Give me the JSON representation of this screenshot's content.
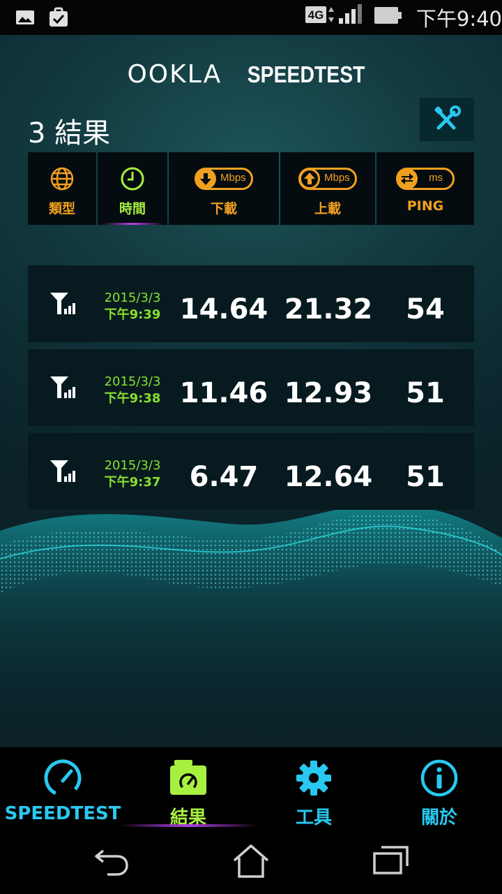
{
  "status_bar": {
    "network": "4G",
    "time": "下午9:40",
    "left_icons": [
      "gallery-icon",
      "clipboard-check-icon"
    ]
  },
  "brand": {
    "ookla": "OOKLA",
    "speedtest": "SPEEDTEST"
  },
  "results": {
    "title": "3 結果",
    "tools_icon": "wrench-screwdriver-icon"
  },
  "columns": [
    {
      "label": "類型",
      "icon": "globe-icon"
    },
    {
      "label": "時間",
      "icon": "clock-icon",
      "active": true
    },
    {
      "label": "下載",
      "icon": "arrow-down-icon",
      "unit": "Mbps"
    },
    {
      "label": "上載",
      "icon": "arrow-up-icon",
      "unit": "Mbps"
    },
    {
      "label": "PING",
      "icon": "ping-arrows-icon",
      "unit": "ms"
    }
  ],
  "rows": [
    {
      "date": "2015/3/3",
      "time": "下午9:39",
      "download": "14.64",
      "upload": "21.32",
      "ping": "54"
    },
    {
      "date": "2015/3/3",
      "time": "下午9:38",
      "download": "11.46",
      "upload": "12.93",
      "ping": "51"
    },
    {
      "date": "2015/3/3",
      "time": "下午9:37",
      "download": "6.47",
      "upload": "12.64",
      "ping": "51"
    }
  ],
  "nav": [
    {
      "label": "SPEEDTEST",
      "icon": "speedometer-icon"
    },
    {
      "label": "結果",
      "icon": "results-folder-icon",
      "active": true
    },
    {
      "label": "工具",
      "icon": "gear-icon"
    },
    {
      "label": "關於",
      "icon": "info-icon"
    }
  ],
  "colors": {
    "accent_orange": "#f0a020",
    "accent_green": "#a8f040",
    "accent_blue": "#29c8f0",
    "date_green": "#88e030"
  }
}
